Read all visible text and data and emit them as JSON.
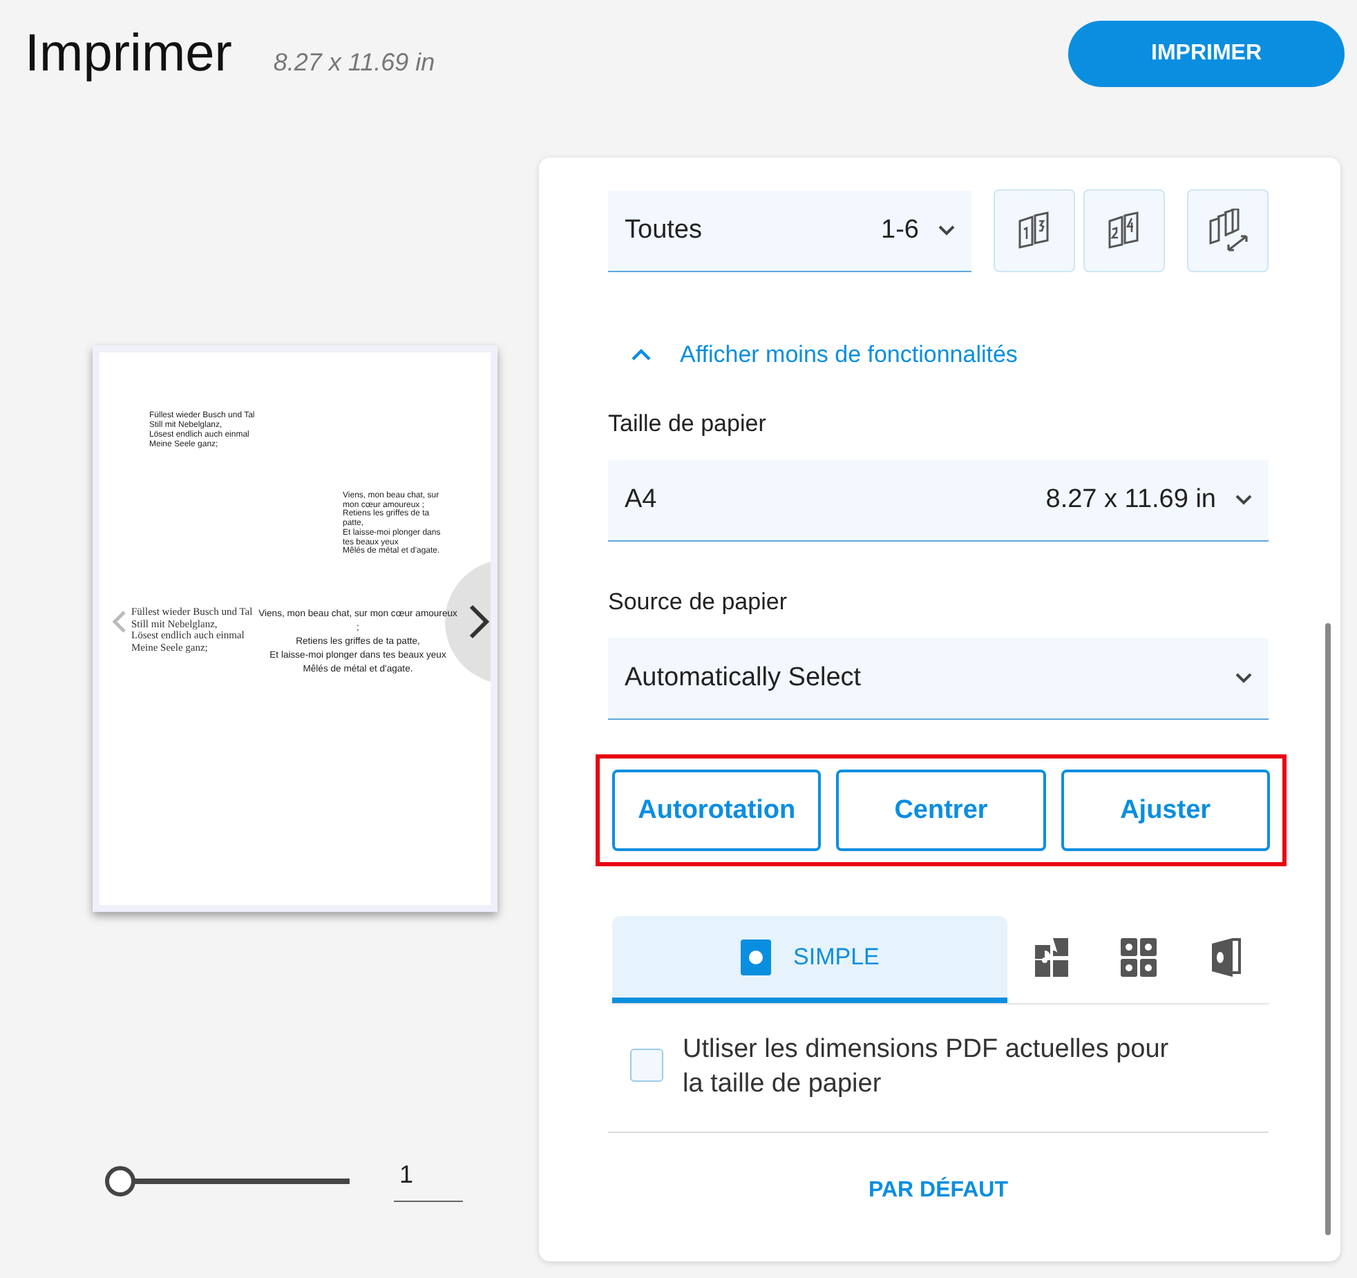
{
  "header": {
    "title": "Imprimer",
    "paper_size": "8.27 x 11.69 in",
    "print_button": "IMPRIMER"
  },
  "preview": {
    "blocks": [
      {
        "kind": "small",
        "lines": [
          "Füllest wieder Busch und Tal",
          "Still mit Nebelglanz,",
          "Lösest endlich auch einmal",
          "Meine Seele ganz;"
        ]
      },
      {
        "kind": "small-right",
        "lines": [
          "Viens, mon beau chat, sur",
          "mon cœur amoureux ;",
          "Retiens les griffes de ta",
          "patte,",
          "Et laisse-moi plonger dans",
          "tes beaux yeux",
          "Mêlés de métal et d'agate."
        ]
      },
      {
        "kind": "serif",
        "lines": [
          "Füllest wieder Busch und Tal",
          "Still mit Nebelglanz,",
          "Lösest endlich auch einmal",
          "Meine Seele ganz;"
        ]
      },
      {
        "kind": "centered",
        "lines": [
          "Viens, mon beau chat, sur mon cœur amoureux ;",
          "Retiens les griffes de ta patte,",
          "Et laisse-moi plonger dans tes beaux yeux",
          "Mêlés de métal et d'agate."
        ]
      }
    ]
  },
  "zoom": {
    "level": 0,
    "page": "1"
  },
  "pages": {
    "value": "Toutes",
    "range": "1-6"
  },
  "page_buttons": [
    {
      "kind": "odd"
    },
    {
      "kind": "even"
    },
    {
      "kind": "collate"
    }
  ],
  "toggle_link": "Afficher moins de fonctionnalités",
  "fields": [
    {
      "label": "Taille de papier",
      "value": "A4",
      "detail": "8.27 x 11.69 in"
    },
    {
      "label": "Source de papier",
      "value": "Automatically Select"
    }
  ],
  "scale_buttons": [
    "Autorotation",
    "Centrer",
    "Ajuster"
  ],
  "tabs": [
    {
      "kind": "simple",
      "label": "SIMPLE",
      "selected": true
    },
    {
      "kind": "booklet",
      "selected": false
    },
    {
      "kind": "grid",
      "selected": false
    },
    {
      "kind": "cover",
      "selected": false
    }
  ],
  "option": {
    "label": "Utliser les dimensions PDF actuelles pour la taille de papier",
    "checked": false
  },
  "default_button": "PAR DÉFAUT"
}
